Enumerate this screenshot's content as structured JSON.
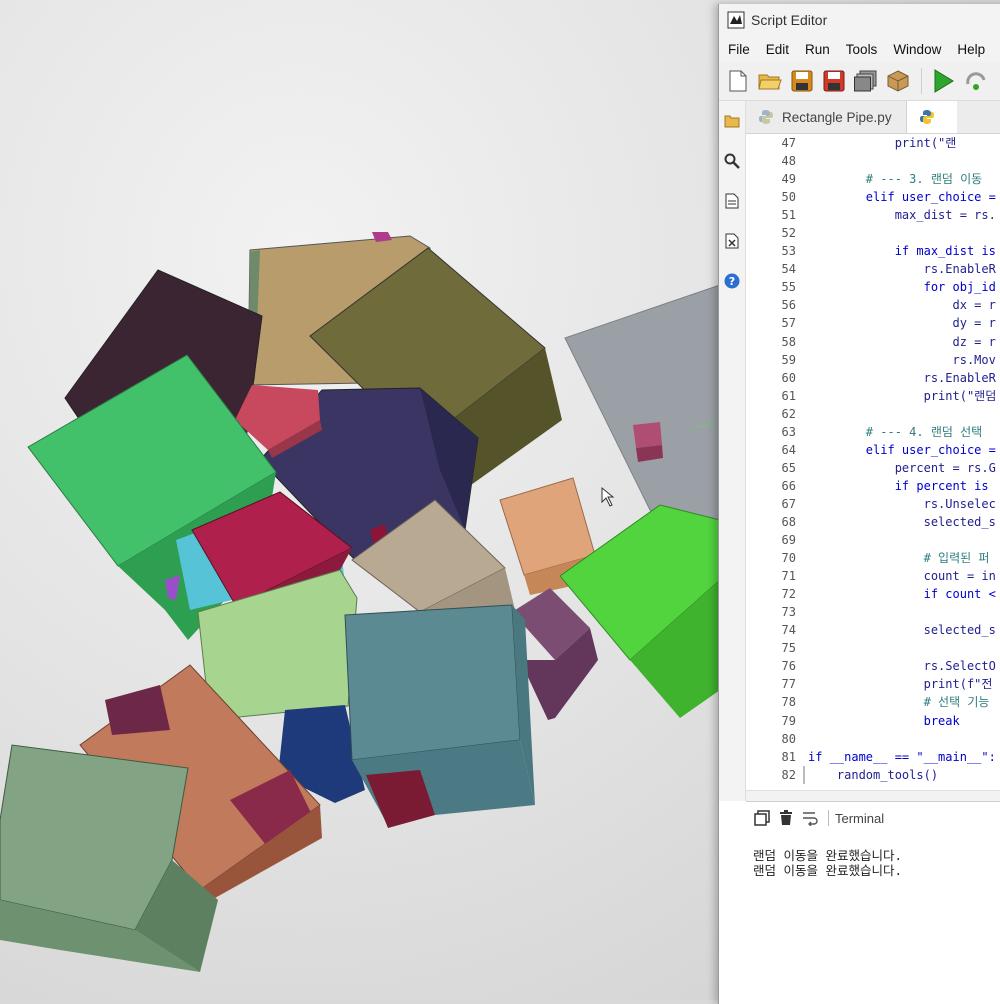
{
  "window": {
    "title": "Script Editor"
  },
  "menu": [
    "File",
    "Edit",
    "Run",
    "Tools",
    "Window",
    "Help"
  ],
  "toolbar": [
    "new-file-icon",
    "open-folder-icon",
    "save-icon",
    "save-as-icon",
    "save-all-icon",
    "package-icon",
    "run-icon",
    "step-icon"
  ],
  "side_rail": [
    "explorer-icon",
    "search-icon",
    "document-icon",
    "excel-icon",
    "help-icon"
  ],
  "tabs": [
    {
      "label": "Rectangle Pipe.py",
      "active": false
    },
    {
      "label": "",
      "active": true
    }
  ],
  "code": {
    "lines": [
      {
        "n": "47",
        "text": "            print(\"랜",
        "cls": "plain"
      },
      {
        "n": "48",
        "text": "",
        "cls": "plain"
      },
      {
        "n": "49",
        "text": "        # --- 3. 랜덤 이동",
        "cls": "cm"
      },
      {
        "n": "50",
        "text": "        elif user_choice =",
        "cls": "kw"
      },
      {
        "n": "51",
        "text": "            max_dist = rs.",
        "cls": "plain"
      },
      {
        "n": "52",
        "text": "",
        "cls": "plain"
      },
      {
        "n": "53",
        "text": "            if max_dist is",
        "cls": "kw"
      },
      {
        "n": "54",
        "text": "                rs.EnableR",
        "cls": "plain"
      },
      {
        "n": "55",
        "text": "                for obj_id",
        "cls": "kw"
      },
      {
        "n": "56",
        "text": "                    dx = r",
        "cls": "plain"
      },
      {
        "n": "57",
        "text": "                    dy = r",
        "cls": "plain"
      },
      {
        "n": "58",
        "text": "                    dz = r",
        "cls": "plain"
      },
      {
        "n": "59",
        "text": "                    rs.Mov",
        "cls": "plain"
      },
      {
        "n": "60",
        "text": "                rs.EnableR",
        "cls": "plain"
      },
      {
        "n": "61",
        "text": "                print(\"랜덤",
        "cls": "plain"
      },
      {
        "n": "62",
        "text": "",
        "cls": "plain"
      },
      {
        "n": "63",
        "text": "        # --- 4. 랜덤 선택",
        "cls": "cm"
      },
      {
        "n": "64",
        "text": "        elif user_choice =",
        "cls": "kw"
      },
      {
        "n": "65",
        "text": "            percent = rs.G",
        "cls": "plain"
      },
      {
        "n": "66",
        "text": "            if percent is",
        "cls": "kw"
      },
      {
        "n": "67",
        "text": "                rs.Unselec",
        "cls": "plain"
      },
      {
        "n": "68",
        "text": "                selected_s",
        "cls": "plain"
      },
      {
        "n": "69",
        "text": "",
        "cls": "plain"
      },
      {
        "n": "70",
        "text": "                # 입력된 퍼",
        "cls": "cm"
      },
      {
        "n": "71",
        "text": "                count = in",
        "cls": "plain"
      },
      {
        "n": "72",
        "text": "                if count <",
        "cls": "kw"
      },
      {
        "n": "73",
        "text": "",
        "cls": "plain"
      },
      {
        "n": "74",
        "text": "                selected_s",
        "cls": "plain"
      },
      {
        "n": "75",
        "text": "",
        "cls": "plain"
      },
      {
        "n": "76",
        "text": "                rs.SelectO",
        "cls": "plain"
      },
      {
        "n": "77",
        "text": "                print(f\"전",
        "cls": "plain"
      },
      {
        "n": "78",
        "text": "                # 선택 기능",
        "cls": "cm"
      },
      {
        "n": "79",
        "text": "                break",
        "cls": "kw"
      },
      {
        "n": "80",
        "text": "",
        "cls": "plain"
      },
      {
        "n": "81",
        "text": "if __name__ == \"__main__\":",
        "cls": "kw"
      },
      {
        "n": "82",
        "text": "    random_tools()",
        "cls": "plain"
      }
    ]
  },
  "terminal": {
    "label": "Terminal",
    "buttons": [
      "copy-icon",
      "trash-icon",
      "word-wrap-icon"
    ],
    "output": [
      "랜덤 이동을 완료했습니다.",
      "랜덤 이동을 완료했습니다."
    ]
  },
  "colors": {
    "accent": "#3c78d8",
    "run_green": "#2ea62e",
    "editor_bg": "#ffffff"
  }
}
